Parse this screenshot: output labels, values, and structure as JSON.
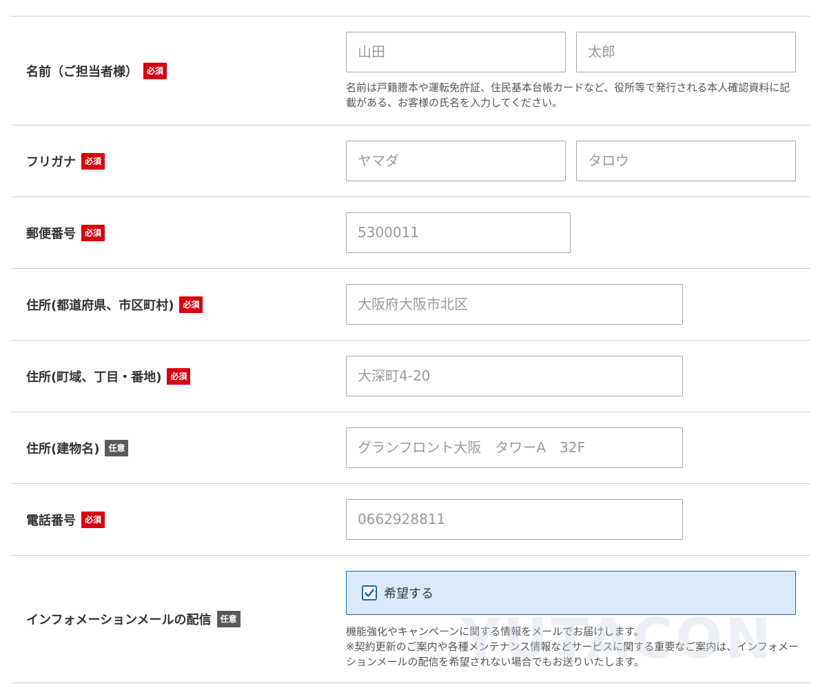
{
  "form": {
    "rows": [
      {
        "label": "名前（ご担当者様）",
        "badge": "必須",
        "inputs": [
          {
            "placeholder": "山田"
          },
          {
            "placeholder": "太郎"
          }
        ],
        "note": "名前は戸籍謄本や運転免許証、住民基本台帳カードなど、役所等で発行される本人確認資料に記載がある、お客様の氏名を入力してください。"
      },
      {
        "label": "フリガナ",
        "badge": "必須",
        "inputs": [
          {
            "placeholder": "ヤマダ"
          },
          {
            "placeholder": "タロウ"
          }
        ]
      },
      {
        "label": "郵便番号",
        "badge": "必須",
        "inputs": [
          {
            "placeholder": "5300011"
          }
        ]
      },
      {
        "label": "住所(都道府県、市区町村)",
        "badge": "必須",
        "inputs": [
          {
            "placeholder": "大阪府大阪市北区"
          }
        ]
      },
      {
        "label": "住所(町域、丁目・番地)",
        "badge": "必須",
        "inputs": [
          {
            "placeholder": "大深町4-20"
          }
        ]
      },
      {
        "label": "住所(建物名)",
        "badge": "任意",
        "inputs": [
          {
            "placeholder": "グランフロント大阪　タワーA　32F"
          }
        ]
      },
      {
        "label": "電話番号",
        "badge": "必須",
        "inputs": [
          {
            "placeholder": "0662928811"
          }
        ]
      },
      {
        "label": "インフォメーションメールの配信",
        "badge": "任意",
        "checkbox": {
          "label": "希望する",
          "checked": true
        },
        "note_lines": [
          "機能強化やキャンペーンに関する情報をメールでお届けします。",
          "※契約更新のご案内や各種メンテナンス情報などサービスに関する重要なご案内は、インフォメーションメールの配信を希望されない場合でもお送りいたします。"
        ]
      }
    ]
  },
  "watermark": "YUTACON",
  "colors": {
    "required_badge": "#d7000f",
    "optional_badge": "#5a5a5a",
    "check_accent": "#1b66a8",
    "check_background": "#dbeafb",
    "divider": "#d2d2d2"
  }
}
